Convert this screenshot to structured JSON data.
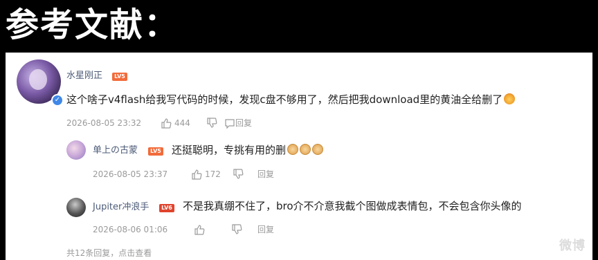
{
  "heading": "参考文献：",
  "main_comment": {
    "username": "水星刚正",
    "badge": "LV5",
    "text": "这个啥子v4flash给我写代码的时候，发现c盘不够用了，然后把我download里的黄油全给删了",
    "emoji": "angry-face-emoji",
    "date": "2026-08-05 23:32",
    "likes": "444",
    "reply_label": "回复"
  },
  "replies": [
    {
      "username": "单上の古蒙",
      "badge": "LV5",
      "text": "还挺聪明，专挑有用的删",
      "emojis": [
        "doge-emoji",
        "doge-emoji",
        "doge-emoji"
      ],
      "date": "2026-08-05 23:37",
      "likes": "172",
      "reply_label": "回复"
    },
    {
      "username": "Jupiter冲浪手",
      "badge": "LV6",
      "text": "不是我真绷不住了，bro介不介意我截个图做成表情包，不会包含你头像的",
      "date": "2026-08-06 01:06",
      "likes": "",
      "reply_label": "回复"
    }
  ],
  "footer": {
    "more_replies": "共12条回复，点击查看",
    "watermark": "微博"
  },
  "colors": {
    "username": "#4c5b77",
    "meta": "#9a9a9a",
    "badge": "#f26b3a"
  }
}
